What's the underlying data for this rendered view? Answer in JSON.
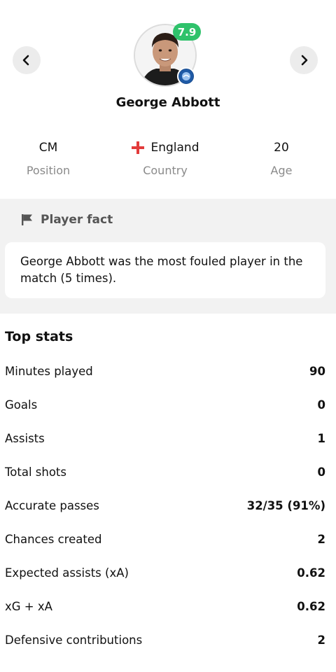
{
  "player": {
    "name": "George Abbott",
    "rating": "7.9",
    "position": "CM",
    "position_label": "Position",
    "country": "England",
    "country_label": "Country",
    "age": "20",
    "age_label": "Age"
  },
  "colors": {
    "rating_badge": "#2fc26b",
    "flag_cross": "#e23b3b",
    "section_bg": "#f2f2f2"
  },
  "fact": {
    "title": "Player fact",
    "text": "George Abbott was the most fouled player in the match (5 times)."
  },
  "stats": {
    "title": "Top stats",
    "rows": [
      {
        "label": "Minutes played",
        "value": "90"
      },
      {
        "label": "Goals",
        "value": "0"
      },
      {
        "label": "Assists",
        "value": "1"
      },
      {
        "label": "Total shots",
        "value": "0"
      },
      {
        "label": "Accurate passes",
        "value": "32/35 (91%)"
      },
      {
        "label": "Chances created",
        "value": "2"
      },
      {
        "label": "Expected assists (xA)",
        "value": "0.62"
      },
      {
        "label": "xG + xA",
        "value": "0.62"
      },
      {
        "label": "Defensive contributions",
        "value": "2"
      }
    ]
  }
}
